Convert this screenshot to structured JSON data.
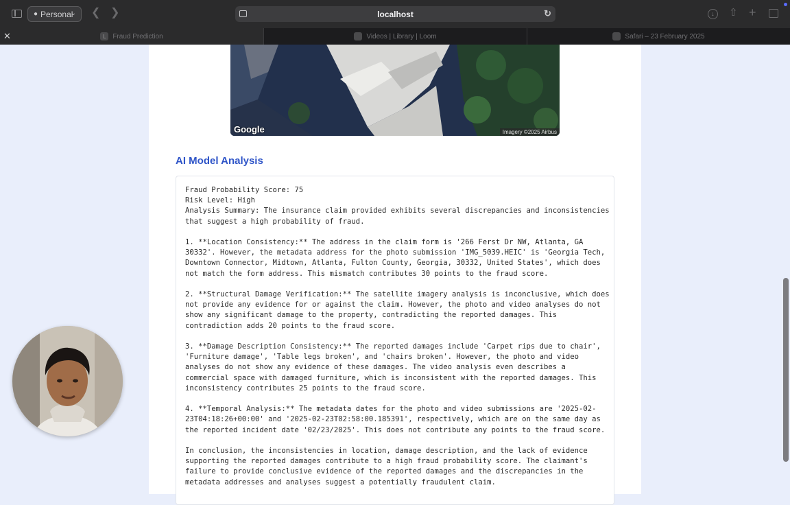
{
  "browser": {
    "profile_label": "Personal",
    "url": "localhost",
    "tabs": [
      {
        "label": "Fraud Prediction",
        "favicon": "L"
      },
      {
        "label": "Videos | Library | Loom",
        "favicon": ""
      },
      {
        "label": "Safari – 23 February 2025",
        "favicon": ""
      }
    ]
  },
  "map": {
    "logo": "Google",
    "attribution": "Imagery ©2025 Airbus"
  },
  "analysis": {
    "title": "AI Model Analysis",
    "lines": [
      "Fraud Probability Score: 75",
      "Risk Level: High",
      "Analysis Summary: The insurance claim provided exhibits several discrepancies and inconsistencies",
      "that suggest a high probability of fraud.",
      "",
      "1. **Location Consistency:** The address in the claim form is '266 Ferst Dr NW, Atlanta, GA",
      "30332'. However, the metadata address for the photo submission 'IMG_5039.HEIC' is 'Georgia Tech,",
      "Downtown Connector, Midtown, Atlanta, Fulton County, Georgia, 30332, United States', which does",
      "not match the form address. This mismatch contributes 30 points to the fraud score.",
      "",
      "2. **Structural Damage Verification:** The satellite imagery analysis is inconclusive, which does",
      "not provide any evidence for or against the claim. However, the photo and video analyses do not",
      "show any significant damage to the property, contradicting the reported damages. This",
      "contradiction adds 20 points to the fraud score.",
      "",
      "3. **Damage Description Consistency:** The reported damages include 'Carpet rips due to chair',",
      "'Furniture damage', 'Table legs broken', and 'chairs broken'. However, the photo and video",
      "analyses do not show any evidence of these damages. The video analysis even describes a",
      "commercial space with damaged furniture, which is inconsistent with the reported damages. This",
      "inconsistency contributes 25 points to the fraud score.",
      "",
      "4. **Temporal Analysis:** The metadata dates for the photo and video submissions are '2025-02-",
      "23T04:18:26+00:00' and '2025-02-23T02:58:00.185391', respectively, which are on the same day as",
      "the reported incident date '02/23/2025'. This does not contribute any points to the fraud score.",
      "",
      "In conclusion, the inconsistencies in location, damage description, and the lack of evidence",
      "supporting the reported damages contribute to a high fraud probability score. The claimant's",
      "failure to provide conclusive evidence of the reported damages and the discrepancies in the",
      "metadata addresses and analyses suggest a potentially fraudulent claim."
    ]
  },
  "colors": {
    "accent": "#2f55c8",
    "page_bg": "#e9eefb"
  }
}
